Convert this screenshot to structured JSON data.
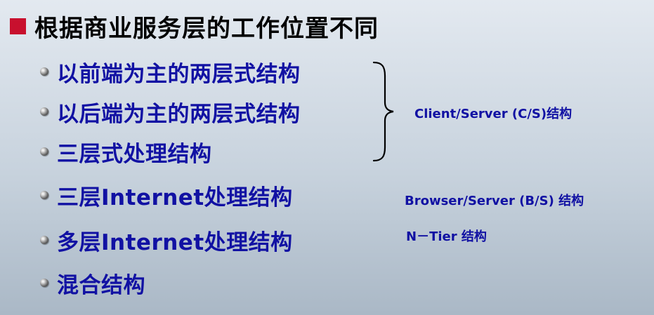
{
  "heading": "根据商业服务层的工作位置不同",
  "items": [
    "以前端为主的两层式结构",
    "以后端为主的两层式结构",
    "三层式处理结构",
    "三层Internet处理结构",
    "多层Internet处理结构",
    "混合结构"
  ],
  "notes": {
    "cs": "Client/Server (C/S)结构",
    "bs": "Browser/Server (B/S) 结构",
    "ntier": "N－Tier 结构"
  },
  "colors": {
    "heading_square": "#c8102e",
    "item_text": "#1111a3",
    "heading_text": "#000000"
  }
}
